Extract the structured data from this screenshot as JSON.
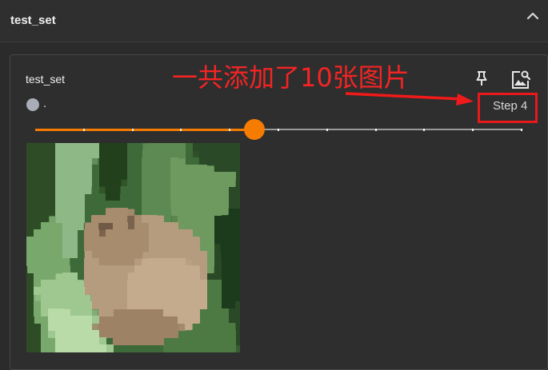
{
  "header": {
    "title": "test_set"
  },
  "card": {
    "title": "test_set",
    "run_label": ".",
    "step_label": "Step 4",
    "annotation": "一共添加了10张图片"
  },
  "slider": {
    "steps": 10,
    "current_index": 4
  },
  "colors": {
    "accent": "#f57c00",
    "annotation": "#f52424",
    "run_dot": "#a9adb7",
    "background": "#2b2b2b"
  },
  "icons": {
    "collapse": "chevron-up-icon",
    "pin": "pin-icon",
    "image_search": "image-search-icon",
    "run": "run-color-dot"
  },
  "image": {
    "subject": "frog"
  }
}
